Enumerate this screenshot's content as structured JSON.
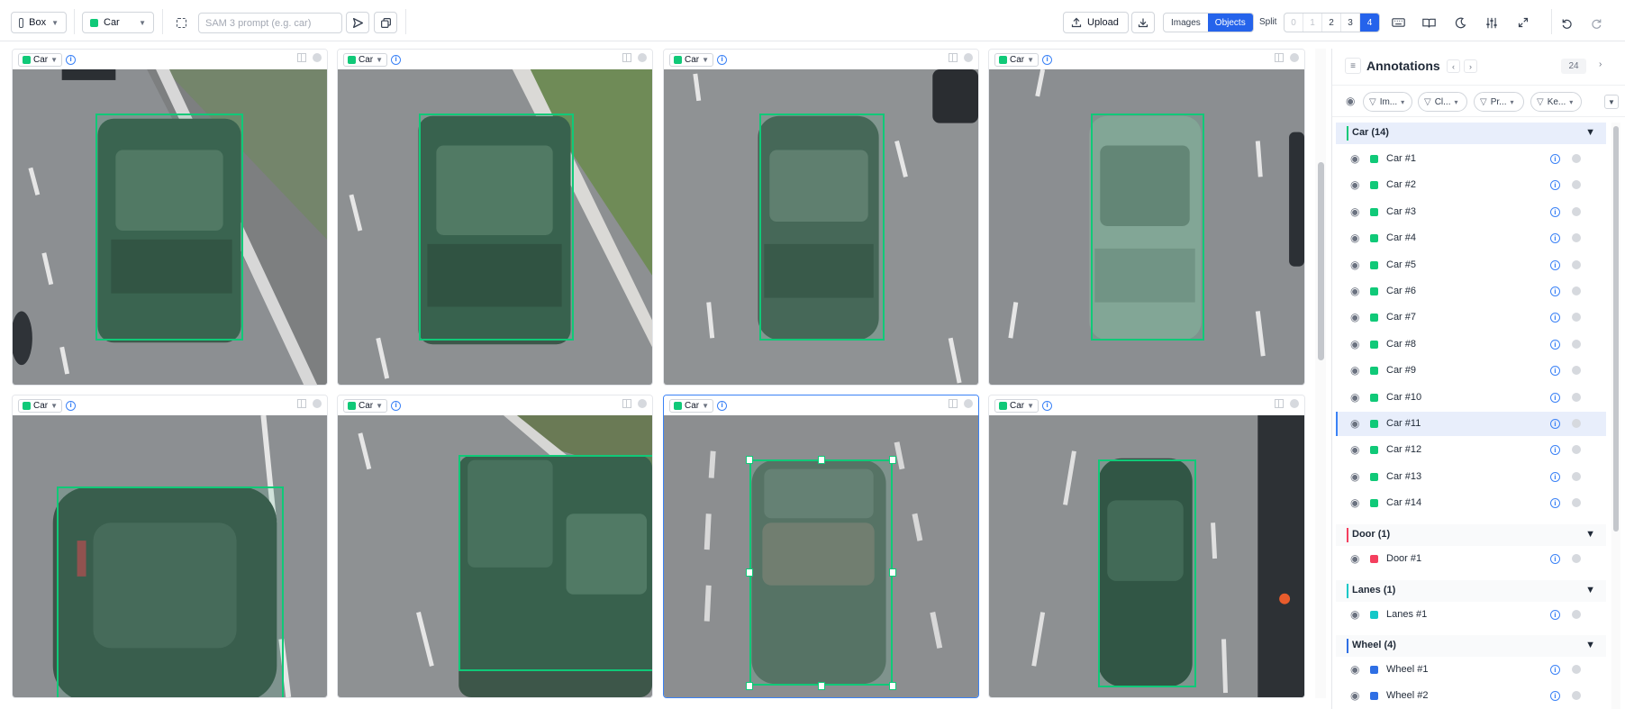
{
  "toolbar": {
    "tool_label": "Box",
    "class_label": "Car",
    "class_color": "#10c978",
    "sam_placeholder": "SAM 3 prompt (e.g. car)",
    "upload_label": "Upload",
    "view_images": "Images",
    "view_objects": "Objects",
    "split_label": "Split",
    "split_options": [
      "0",
      "1",
      "2",
      "3",
      "4"
    ],
    "split_selected": "4"
  },
  "tiles": [
    {
      "label": "Car"
    },
    {
      "label": "Car"
    },
    {
      "label": "Car"
    },
    {
      "label": "Car"
    },
    {
      "label": "Car"
    },
    {
      "label": "Car"
    },
    {
      "label": "Car"
    },
    {
      "label": "Car"
    }
  ],
  "panel": {
    "title": "Annotations",
    "count": "24",
    "filters": [
      "Im...",
      "Cl...",
      "Pr...",
      "Ke..."
    ],
    "groups": [
      {
        "label": "Car (14)",
        "color": "#10c978",
        "items": [
          "Car #1",
          "Car #2",
          "Car #3",
          "Car #4",
          "Car #5",
          "Car #6",
          "Car #7",
          "Car #8",
          "Car #9",
          "Car #10",
          "Car #11",
          "Car #12",
          "Car #13",
          "Car #14"
        ]
      },
      {
        "label": "Door (1)",
        "color": "#f43f5e",
        "items": [
          "Door #1"
        ]
      },
      {
        "label": "Lanes (1)",
        "color": "#14c8c8",
        "items": [
          "Lanes #1"
        ]
      },
      {
        "label": "Wheel (4)",
        "color": "#2f6fe4",
        "items": [
          "Wheel #1",
          "Wheel #2"
        ]
      }
    ]
  },
  "colors": {
    "accent": "#2563eb",
    "car": "#10c978",
    "door": "#f43f5e",
    "lanes": "#14c8c8",
    "wheel": "#2f6fe4"
  }
}
